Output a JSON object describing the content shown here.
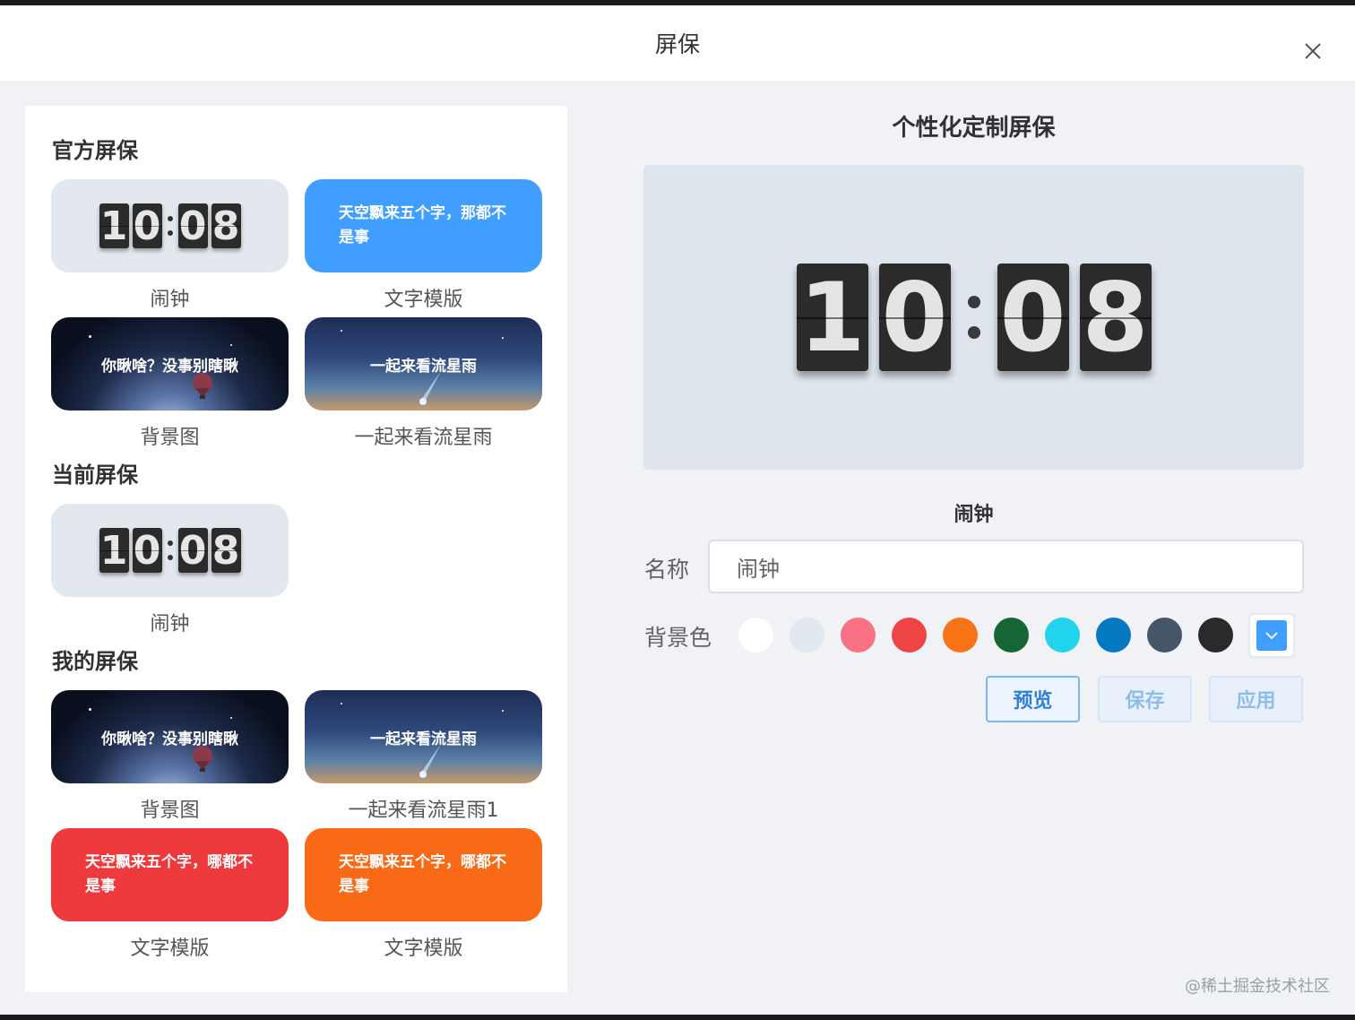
{
  "dialog": {
    "title": "屏保"
  },
  "left": {
    "official": {
      "title": "官方屏保",
      "cards": [
        {
          "type": "clock",
          "digits": [
            "1",
            "0",
            "0",
            "8"
          ],
          "label": "闹钟"
        },
        {
          "type": "text",
          "text": "天空飘来五个字，那都不是事",
          "color": "#409eff",
          "label": "文字模版"
        },
        {
          "type": "night",
          "text": "你瞅啥？没事别瞎瞅",
          "label": "背景图"
        },
        {
          "type": "sky",
          "text": "一起来看流星雨",
          "label": "一起来看流星雨"
        }
      ]
    },
    "current": {
      "title": "当前屏保",
      "cards": [
        {
          "type": "clock",
          "digits": [
            "1",
            "0",
            "0",
            "8"
          ],
          "label": "闹钟"
        }
      ]
    },
    "mine": {
      "title": "我的屏保",
      "cards": [
        {
          "type": "night",
          "text": "你瞅啥？没事别瞎瞅",
          "label": "背景图"
        },
        {
          "type": "sky",
          "text": "一起来看流星雨",
          "label": "一起来看流星雨1"
        },
        {
          "type": "text",
          "text": "天空飘来五个字，哪都不是事",
          "color": "#ee3a3d",
          "label": "文字模版"
        },
        {
          "type": "text",
          "text": "天空飘来五个字，哪都不是事",
          "color": "#f96a16",
          "label": "文字模版"
        }
      ]
    }
  },
  "right": {
    "title": "个性化定制屏保",
    "preview": {
      "digits": [
        "1",
        "0",
        "0",
        "8"
      ],
      "name": "闹钟"
    },
    "form": {
      "name_label": "名称",
      "name_value": "闹钟",
      "bg_label": "背景色",
      "colors": [
        "#ffffff",
        "#e2e8f0",
        "#f87185",
        "#ef4444",
        "#f97316",
        "#166534",
        "#22d3ee",
        "#0479c2",
        "#475569",
        "#2a2a2a"
      ],
      "picker_color": "#409eff"
    },
    "buttons": {
      "preview": "预览",
      "save": "保存",
      "apply": "应用"
    }
  },
  "watermark": "@稀土掘金技术社区"
}
